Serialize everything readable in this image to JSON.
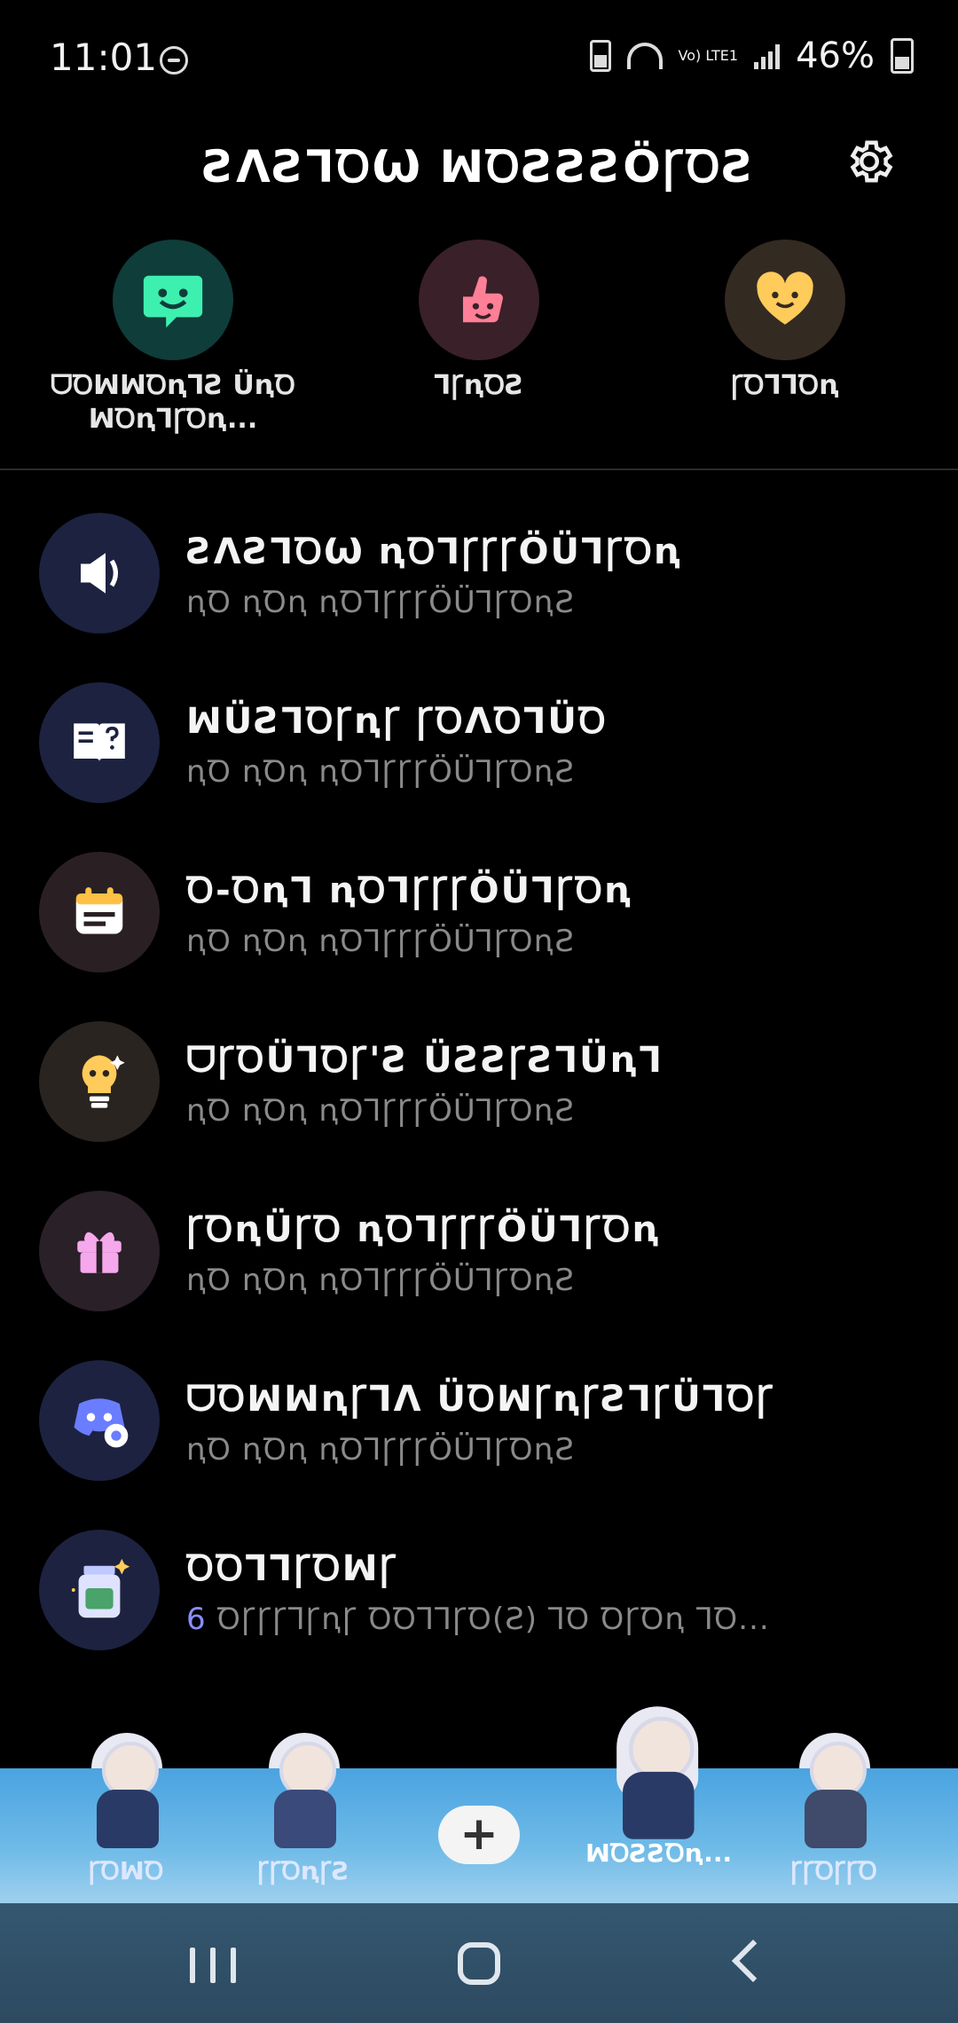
{
  "status_bar": {
    "time": "11:01",
    "battery": "46%",
    "network": "Vo) LTE1"
  },
  "header": {
    "title": "ƧΛƧꞀꝹѠ ꟽꝹƧƧƧÖꞄꝹƧ"
  },
  "quick": [
    {
      "label": "ᗜꝹꟽꟽꝹꞑꞀƧ ÜꞑꝹ ꟽꝹꞑꞀꞄꝹꞑ...",
      "icon": "green-face-icon",
      "bg": "#0f3d3a",
      "fg": "#3ef0b0"
    },
    {
      "label": "ꞀꞄꞑꝹƧ",
      "icon": "pink-thumb-icon",
      "bg": "#3a2028",
      "fg": "#ff7f96"
    },
    {
      "label": "ꞄꝹꞀꞀꝹꞑ",
      "icon": "yellow-heart-icon",
      "bg": "#332a22",
      "fg": "#ffcb5a"
    }
  ],
  "list": [
    {
      "title": "ƧΛƧꞀꝹѠ ꞑꝹꞀꞄꞄꞄÖÜꞀꞄꝹꞑ",
      "sub": "ꞑꝹ ꞑꝹꞑ ꞑꝹꞀꞄꞄꞄÖÜꞀꞄꝹꞑƧ",
      "icon": "speaker-icon",
      "bg": "#1c2240"
    },
    {
      "title": "ꟽÜƧꞀꝹꞄꞑꞄ ꞄꝹΛꝹꞀÜꝹ",
      "sub": "ꞑꝹ ꞑꝹꞑ ꞑꝹꞀꞄꞄꞄÖÜꞀꞄꝹꞑƧ",
      "icon": "help-book-icon",
      "bg": "#1c2240"
    },
    {
      "title": "Ꝺ-ꝹꞑꞀ ꞑꝹꞀꞄꞄꞄÖÜꞀꞄꝹꞑ",
      "sub": "ꞑꝹ ꞑꝹꞑ ꞑꝹꞀꞄꞄꞄÖÜꞀꞄꝹꞑƧ",
      "icon": "calendar-icon",
      "bg": "#2a2024"
    },
    {
      "title": "ᗜꞄꝹÜꞀꝹꞄ'Ƨ ÜƧƧꞄƧꞀÜꞑꞀ",
      "sub": "ꞑꝹ ꞑꝹꞑ ꞑꝹꞀꞄꞄꞄÖÜꞀꞄꝹꞑƧ",
      "icon": "assistant-bulb-icon",
      "bg": "#2a2420"
    },
    {
      "title": "ꞄꝹꞑÜꞄꝹ ꞑꝹꞀꞄꞄꞄÖÜꞀꞄꝹꞑ",
      "sub": "ꞑꝹ ꞑꝹꞑ ꞑꝹꞀꞄꞄꞄÖÜꞀꞄꝹꞑƧ",
      "icon": "gift-icon",
      "bg": "#2a2028"
    },
    {
      "title": "ᗜꝹꟽꟽꞑꞄꞀΛ ÜꝹꟽꞄꞑꞄƧꞀꞄÜꞀꝹꞄ",
      "sub": "ꞑꝹ ꞑꝹꞑ ꞑꝹꞀꞄꞄꞄÖÜꞀꞄꝹꞑƧ",
      "icon": "discord-admin-icon",
      "bg": "#1c2240"
    },
    {
      "title": "ꝹꝹꞀꞀꞄꝹꟽꞄ",
      "count": "6",
      "sub": "ꝹꞄꞄꞄꞀꞄꞑꞄ ꝹꝹꞀꞀꞄꝹ(Ƨ) ꞀꝹ ꝹꞄꝹꞑ ꞀꝹ...",
      "icon": "bottle-icon",
      "bg": "#1c2240"
    }
  ],
  "characters": [
    {
      "name": "ꞄꝹꟽꝹ"
    },
    {
      "name": "ꞄꞄꝹꞑꞄƧ"
    },
    {
      "name": "ꟽꝹƧƧꝹꞑ..."
    },
    {
      "name": "ꞄꞄꝹꞄꞄꝹ"
    }
  ],
  "charbar": {
    "add_label": "+"
  }
}
